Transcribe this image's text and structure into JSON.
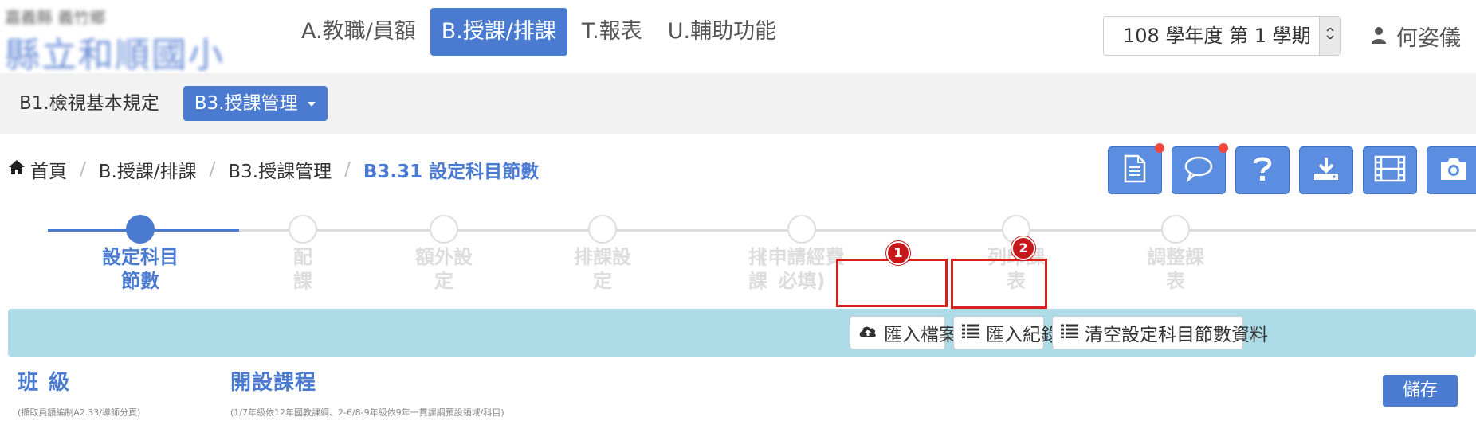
{
  "header": {
    "school_line1": "嘉義縣 義竹鄉",
    "school_line2": "縣立和順國小",
    "nav": [
      {
        "label": "A.教職/員額",
        "active": false
      },
      {
        "label": "B.授課/排課",
        "active": true
      },
      {
        "label": "T.報表",
        "active": false
      },
      {
        "label": "U.輔助功能",
        "active": false
      }
    ],
    "term": "108 學年度 第 1 學期",
    "user_name": "何姿儀"
  },
  "subnav": {
    "items": [
      {
        "label": "B1.檢視基本規定",
        "active": false
      },
      {
        "label": "B3.授課管理",
        "active": true
      }
    ]
  },
  "breadcrumb": {
    "home": "首頁",
    "items": [
      "B.授課/排課",
      "B3.授課管理"
    ],
    "current": "B3.31 設定科目節數"
  },
  "tools": [
    {
      "icon": "document-icon",
      "notice": true
    },
    {
      "icon": "chat-icon",
      "notice": true
    },
    {
      "icon": "help-icon",
      "notice": false
    },
    {
      "icon": "download-icon",
      "notice": false
    },
    {
      "icon": "film-icon",
      "notice": false
    },
    {
      "icon": "camera-icon",
      "notice": false
    }
  ],
  "steps": [
    {
      "label": "設定科目節數",
      "done": true
    },
    {
      "label": "配課",
      "done": false
    },
    {
      "label": "額外設定",
      "done": false
    },
    {
      "label": "排課設定",
      "done": false
    },
    {
      "label": "排課",
      "done": false
    },
    {
      "label": "(申請經費必填)",
      "done": false
    },
    {
      "label": "列印課表",
      "done": false
    },
    {
      "label": "調整課表",
      "done": false
    }
  ],
  "actions": {
    "import_file": "匯入檔案",
    "import_log": "匯入紀錄",
    "clear": "清空設定科目節數資料"
  },
  "markers": [
    "1",
    "2"
  ],
  "sections": {
    "class_title": "班 級",
    "class_note": "(擷取員額編制A2.33/導師分頁)",
    "course_title": "開設課程",
    "course_note": "(1/7年級依12年國教課綱、2-6/8-9年級依9年一貫課綱預設領域/科目)",
    "save": "儲存"
  },
  "colors": {
    "primary": "#4a7bd0",
    "band": "#aedbe8",
    "highlight": "#d9201f"
  }
}
